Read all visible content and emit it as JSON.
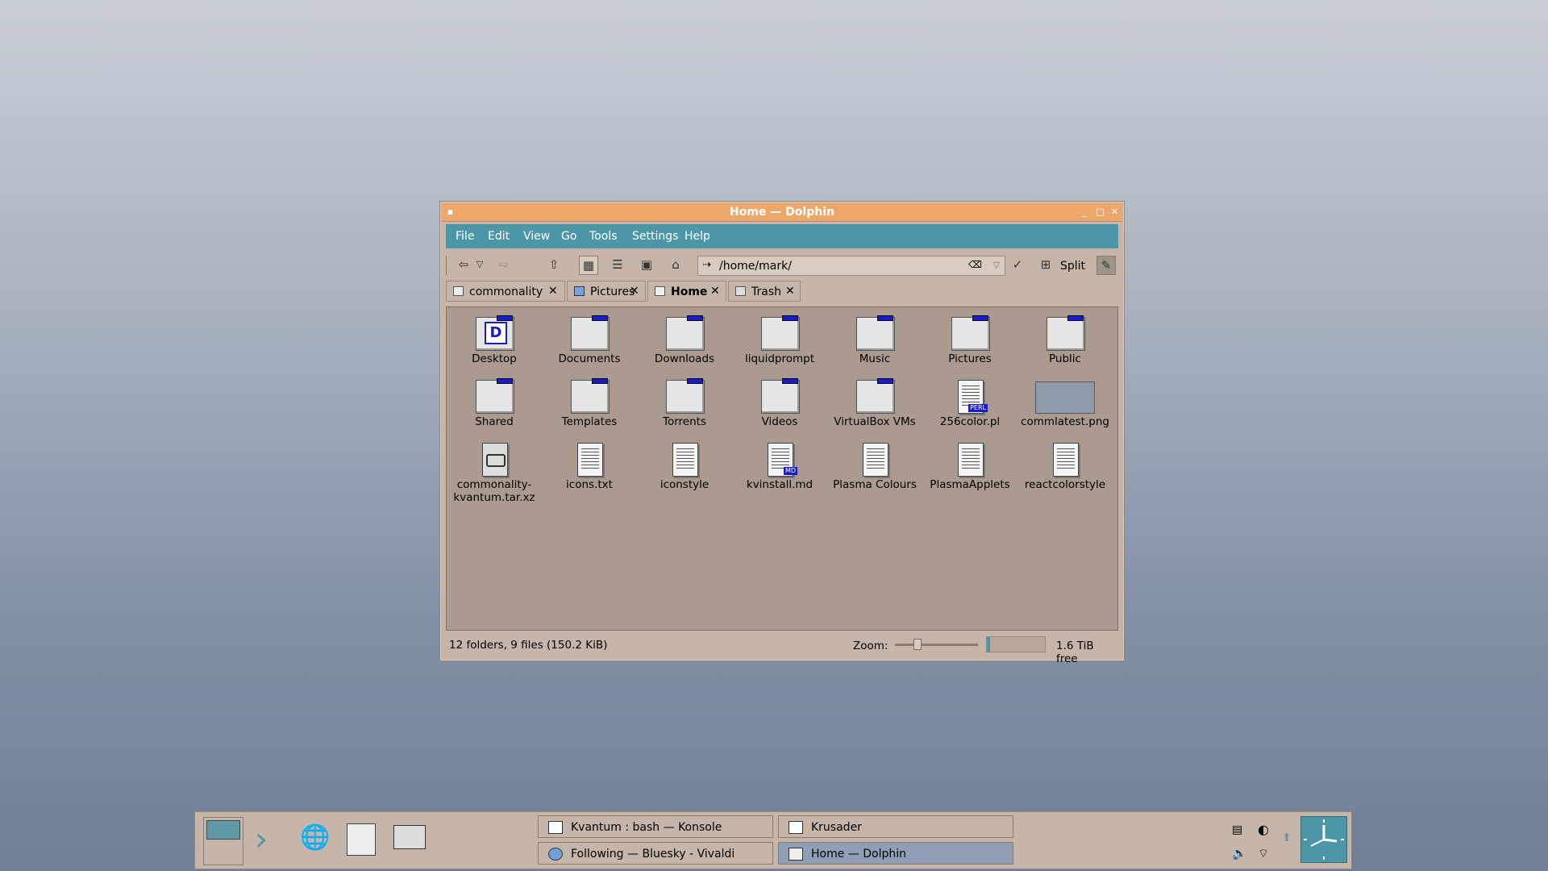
{
  "window": {
    "title": "Home — Dolphin",
    "menu": [
      "File",
      "Edit",
      "View",
      "Go",
      "Tools",
      "Settings",
      "Help"
    ],
    "location_path": "/home/mark/",
    "split_label": "Split",
    "tabs": [
      {
        "label": "commonality",
        "icon": "folder-icon",
        "active": false
      },
      {
        "label": "Pictures",
        "icon": "pictures-icon",
        "active": false
      },
      {
        "label": "Home",
        "icon": "home-icon",
        "active": true
      },
      {
        "label": "Trash",
        "icon": "trash-icon",
        "active": false
      }
    ],
    "items": [
      {
        "label": "Desktop",
        "kind": "folder",
        "glyph": "D"
      },
      {
        "label": "Documents",
        "kind": "folder"
      },
      {
        "label": "Downloads",
        "kind": "folder"
      },
      {
        "label": "liquidprompt",
        "kind": "folder"
      },
      {
        "label": "Music",
        "kind": "folder"
      },
      {
        "label": "Pictures",
        "kind": "folder"
      },
      {
        "label": "Public",
        "kind": "folder"
      },
      {
        "label": "Shared",
        "kind": "folder"
      },
      {
        "label": "Templates",
        "kind": "folder"
      },
      {
        "label": "Torrents",
        "kind": "folder"
      },
      {
        "label": "Videos",
        "kind": "folder"
      },
      {
        "label": "VirtualBox VMs",
        "kind": "folder"
      },
      {
        "label": "256color.pl",
        "kind": "file",
        "badge": "PERL"
      },
      {
        "label": "commlatest.png",
        "kind": "image"
      },
      {
        "label": "commonality-kvantum.tar.xz",
        "kind": "archive"
      },
      {
        "label": "icons.txt",
        "kind": "file"
      },
      {
        "label": "iconstyle",
        "kind": "file"
      },
      {
        "label": "kvinstall.md",
        "kind": "file",
        "badge": "MD"
      },
      {
        "label": "Plasma Colours",
        "kind": "file"
      },
      {
        "label": "PlasmaApplets",
        "kind": "file"
      },
      {
        "label": "reactcolorstyle",
        "kind": "file"
      }
    ],
    "status": {
      "summary": "12 folders, 9 files (150.2 KiB)",
      "zoom_label": "Zoom:",
      "zoom_level": 0.25,
      "free_space": "1.6 TiB free"
    }
  },
  "taskbar": {
    "tasks": [
      {
        "label": "Kvantum : bash — Konsole",
        "icon": "terminal-icon",
        "active": false
      },
      {
        "label": "Krusader",
        "icon": "krusader-icon",
        "active": false
      },
      {
        "label": "Following — Bluesky - Vivaldi",
        "icon": "browser-icon",
        "active": false
      },
      {
        "label": "Home — Dolphin",
        "icon": "dolphin-icon",
        "active": true
      }
    ],
    "launchers": [
      "pager-icon",
      "app-launcher-icon",
      "network-globe-icon",
      "file-manager-icon",
      "terminal-icon"
    ],
    "tray": [
      "clipboard-icon",
      "brightness-icon",
      "updates-icon",
      "volume-icon",
      "wifi-icon"
    ]
  },
  "colors": {
    "menubar": "#4b97a8",
    "titlebar": "#eea76b",
    "window_bg": "#c6b6a9",
    "view_bg": "#ab9a8f",
    "folder_tab": "#1a1ad0"
  }
}
